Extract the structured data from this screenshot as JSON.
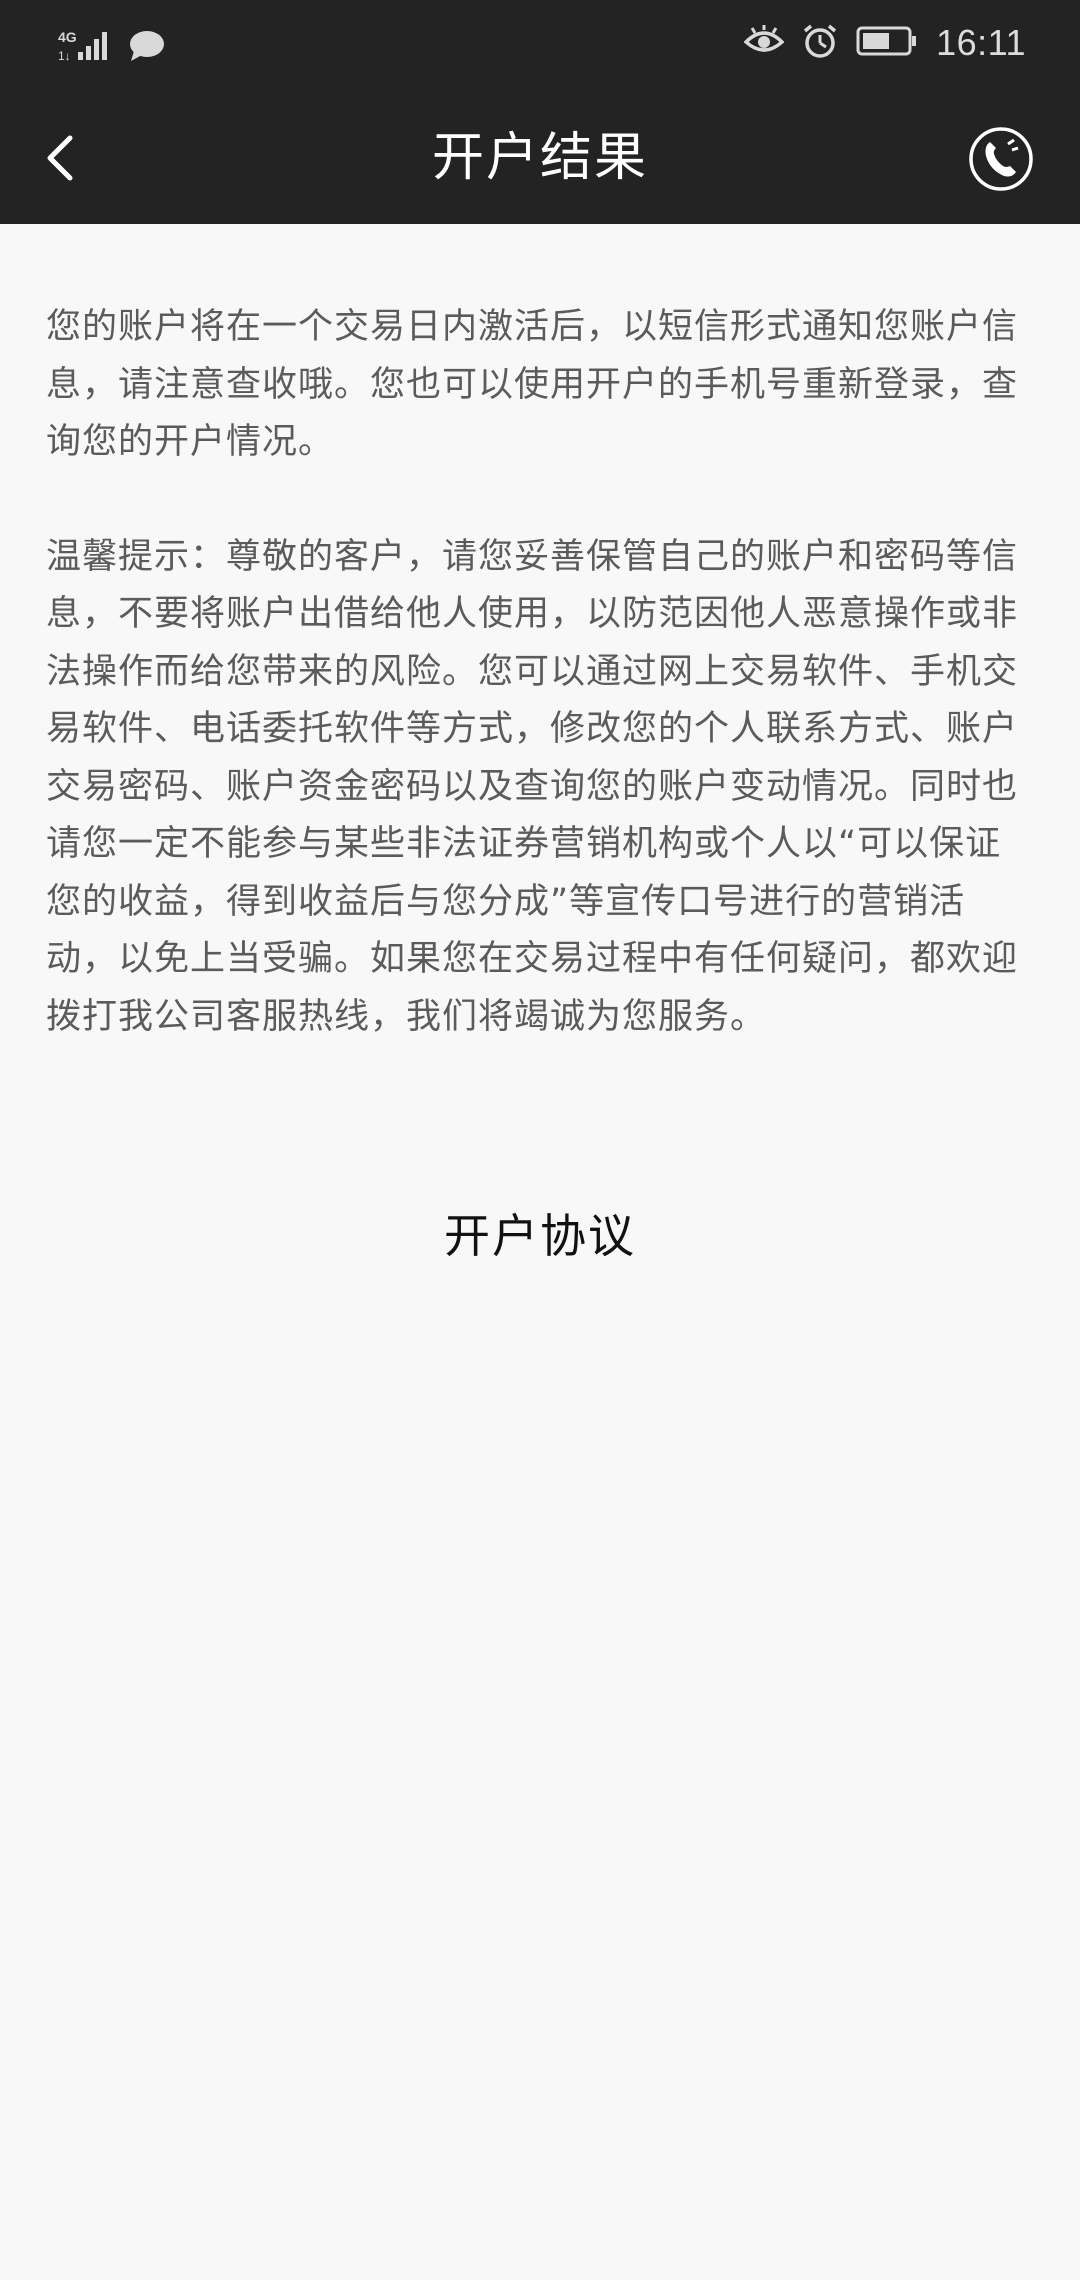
{
  "status_bar": {
    "network_type": "4G",
    "time": "16:11",
    "icons": [
      "signal-icon",
      "chat-bubble-icon",
      "eye-icon",
      "alarm-icon",
      "battery-icon"
    ]
  },
  "app_bar": {
    "title": "开户结果",
    "back_icon": "chevron-left-icon",
    "phone_icon": "phone-icon"
  },
  "content": {
    "paragraph1": "您的账户将在一个交易日内激活后，以短信形式通知您账户信息，请注意查收哦。您也可以使用开户的手机号重新登录，查询您的开户情况。",
    "paragraph2": "温馨提示：尊敬的客户，请您妥善保管自己的账户和密码等信息，不要将账户出借给他人使用，以防范因他人恶意操作或非法操作而给您带来的风险。您可以通过网上交易软件、手机交易软件、电话委托软件等方式，修改您的个人联系方式、账户交易密码、账户资金密码以及查询您的账户变动情况。同时也请您一定不能参与某些非法证券营销机构或个人以“可以保证您的收益，得到收益后与您分成”等宣传口号进行的营销活动，以免上当受骗。如果您在交易过程中有任何疑问，都欢迎拨打我公司客服热线，我们将竭诚为您服务。",
    "agreement_label": "开户协议"
  },
  "colors": {
    "bar_background": "#232323",
    "page_background": "#f8f8f8",
    "body_text": "#5b5b5b",
    "title_text": "#ffffff"
  }
}
